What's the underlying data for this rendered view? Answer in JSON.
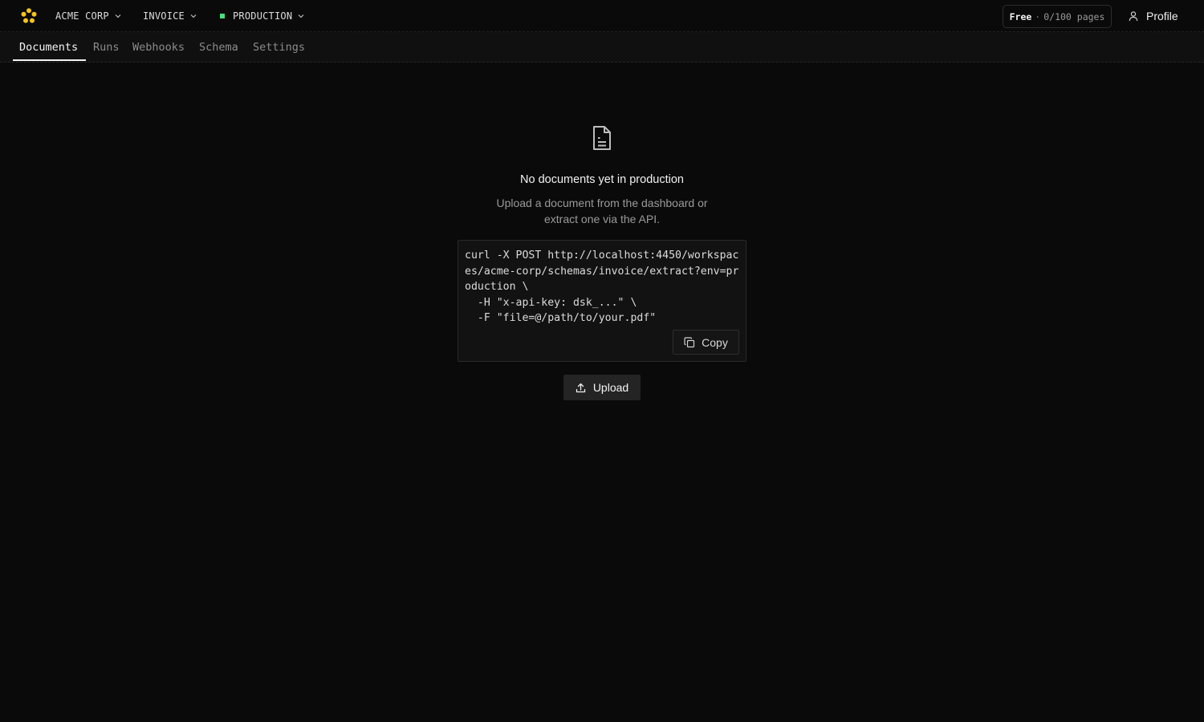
{
  "colors": {
    "background": "#0a0a0a",
    "logo_accent": "#f5c518",
    "environment_indicator": "#4ade80"
  },
  "header": {
    "logo_icon": "sunburst-logo-icon",
    "workspace": "ACME CORP",
    "schema": "INVOICE",
    "environment": "PRODUCTION",
    "plan": {
      "tier": "Free",
      "separator": "·",
      "usage": "0/100 pages"
    },
    "profile": {
      "icon": "user-icon",
      "label": "Profile"
    }
  },
  "tabs": [
    {
      "label": "Documents",
      "active": true
    },
    {
      "label": "Runs",
      "active": false
    },
    {
      "label": "Webhooks",
      "active": false
    },
    {
      "label": "Schema",
      "active": false
    },
    {
      "label": "Settings",
      "active": false
    }
  ],
  "empty_state": {
    "icon": "document-icon",
    "title": "No documents yet in production",
    "subtitle": "Upload a document from the dashboard or extract one via the API.",
    "code": "curl -X POST http://localhost:4450/workspaces/acme-corp/schemas/invoice/extract?env=production \\\n  -H \"x-api-key: dsk_...\" \\\n  -F \"file=@/path/to/your.pdf\"",
    "copy_label": "Copy",
    "copy_icon": "copy-icon",
    "upload_label": "Upload",
    "upload_icon": "upload-icon"
  }
}
